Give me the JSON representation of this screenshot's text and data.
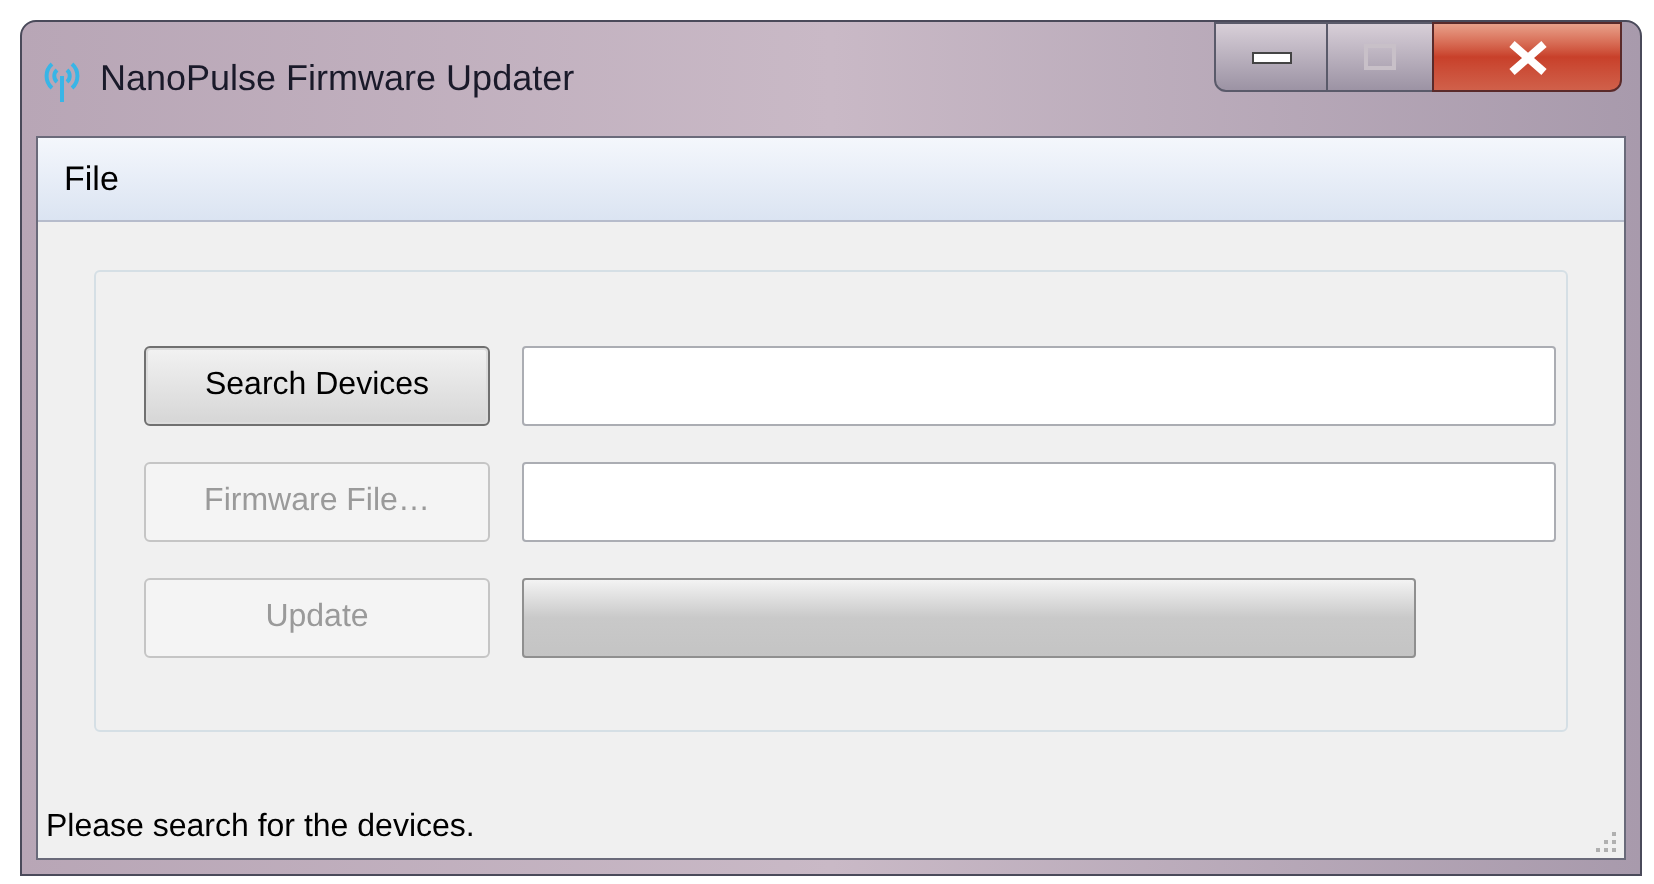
{
  "window": {
    "title": "NanoPulse Firmware Updater"
  },
  "menu": [
    "File"
  ],
  "rows": [
    {
      "button": {
        "label": "Search Devices",
        "disabled": false,
        "focused": true
      },
      "kind": "field"
    },
    {
      "button": {
        "label": "Firmware File…",
        "disabled": true,
        "focused": false
      },
      "kind": "field"
    },
    {
      "button": {
        "label": "Update",
        "disabled": true,
        "focused": false
      },
      "kind": "progress",
      "level": 0
    }
  ],
  "status_bar": "Please search for the devices."
}
